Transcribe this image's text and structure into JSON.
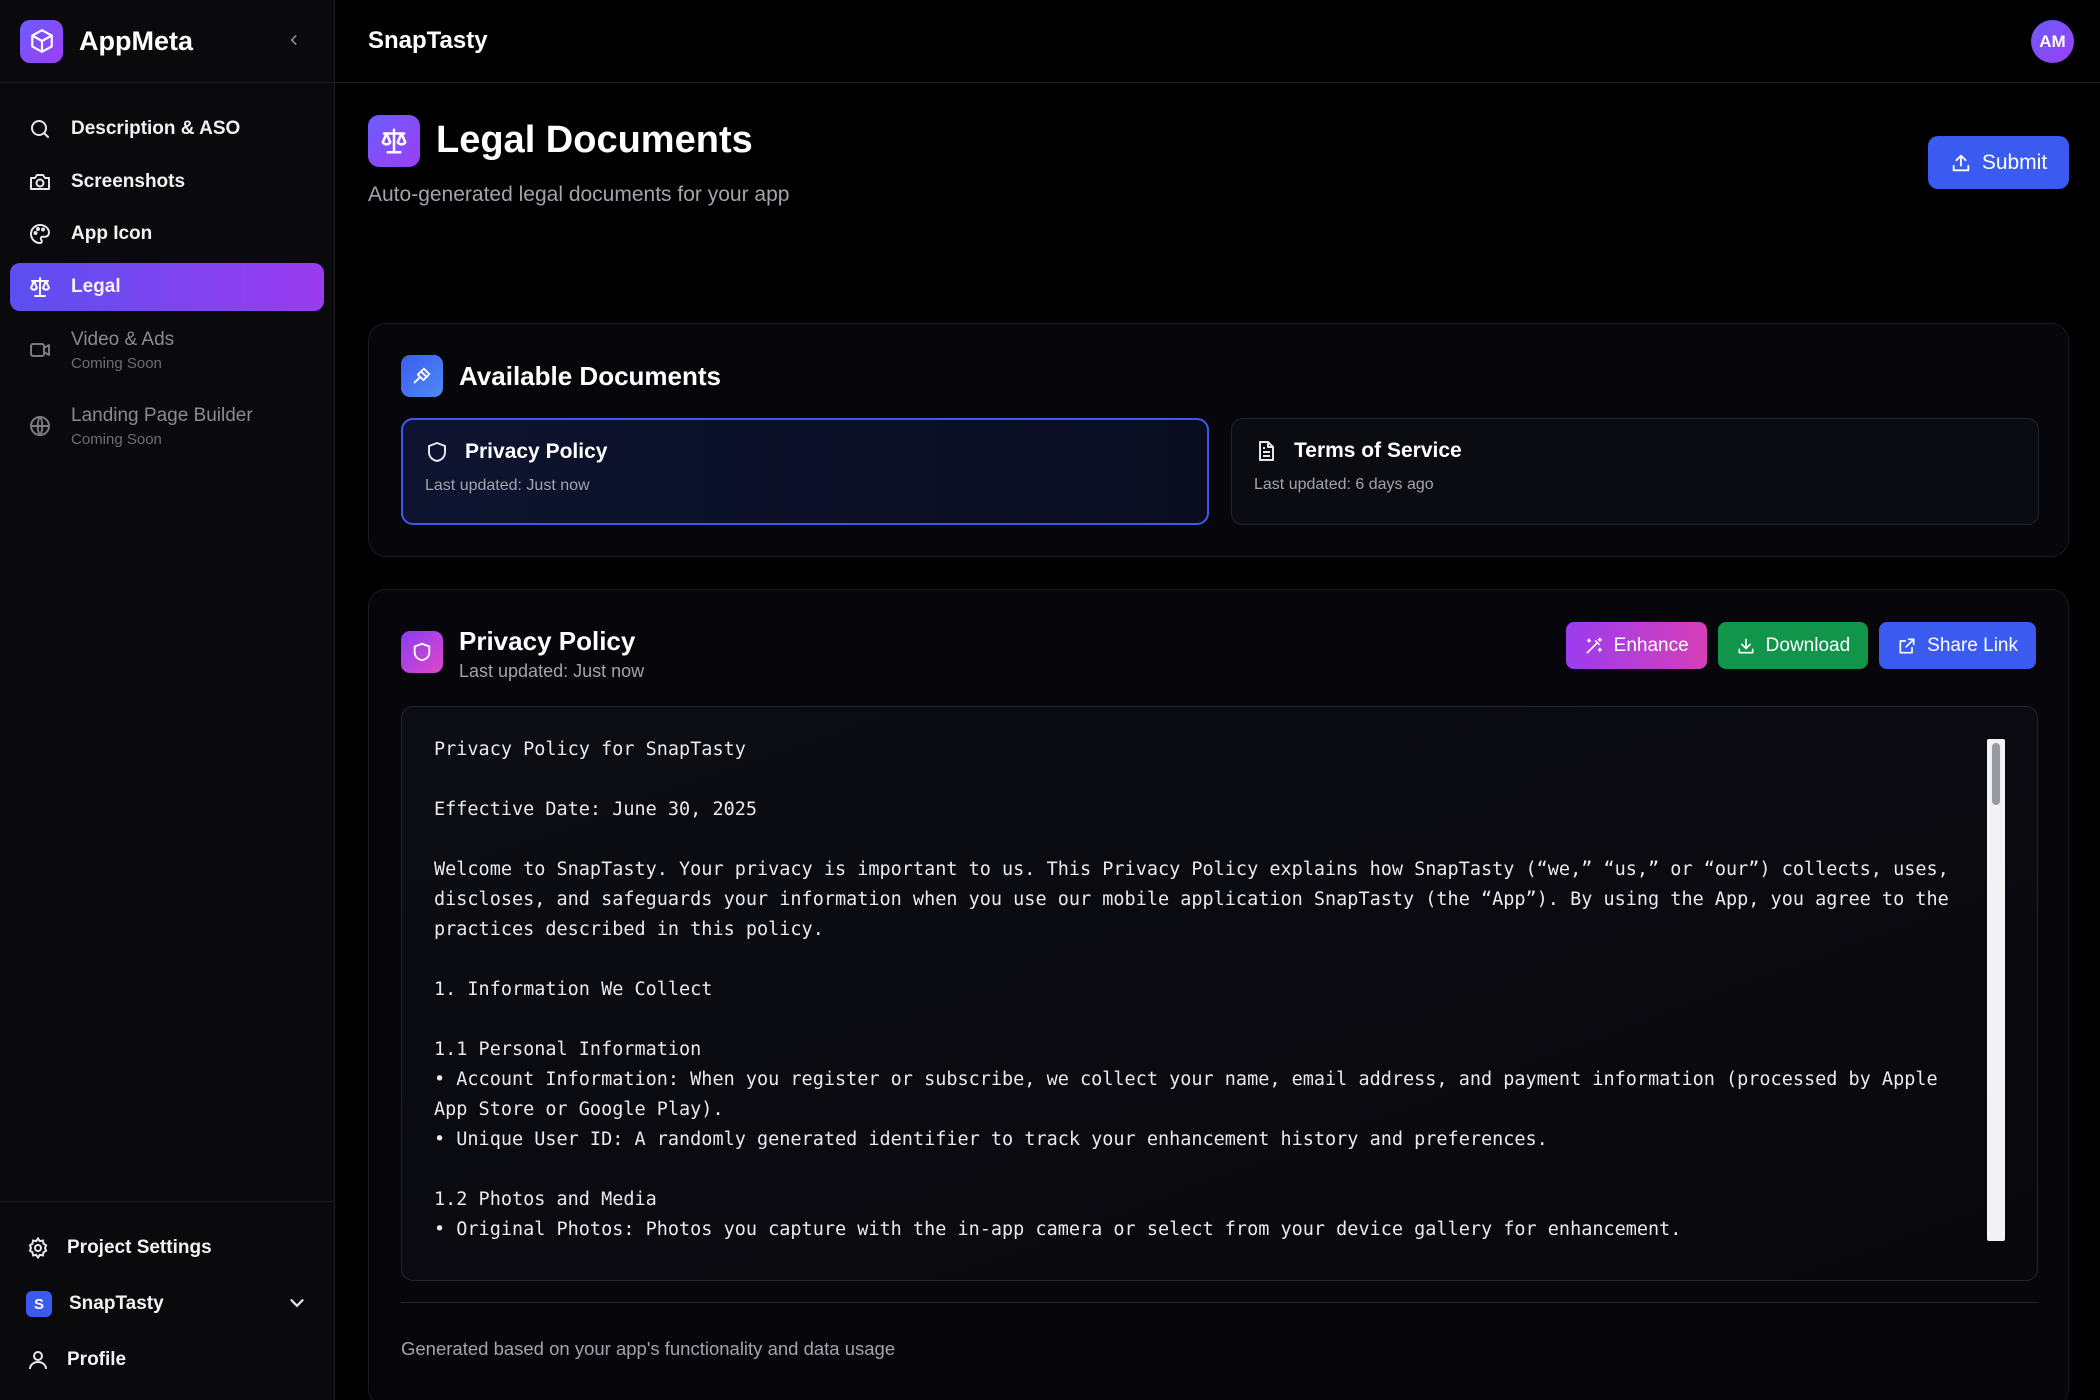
{
  "sidebar": {
    "brand": "AppMeta",
    "items": [
      {
        "label": "Description & ASO",
        "icon": "search-icon"
      },
      {
        "label": "Screenshots",
        "icon": "camera-icon"
      },
      {
        "label": "App Icon",
        "icon": "palette-icon"
      },
      {
        "label": "Legal",
        "icon": "scale-icon",
        "active": true
      },
      {
        "label": "Video & Ads",
        "sub": "Coming Soon",
        "icon": "video-icon"
      },
      {
        "label": "Landing Page Builder",
        "sub": "Coming Soon",
        "icon": "globe-icon"
      }
    ],
    "footer": {
      "settings": "Project Settings",
      "project_badge": "S",
      "project_name": "SnapTasty",
      "profile": "Profile"
    }
  },
  "topbar": {
    "app_name": "SnapTasty",
    "avatar_initials": "AM"
  },
  "page": {
    "title": "Legal Documents",
    "subtitle": "Auto-generated legal documents for your app",
    "submit_label": "Submit"
  },
  "available": {
    "title": "Available Documents",
    "docs": [
      {
        "title": "Privacy Policy",
        "updated": "Last updated: Just now",
        "selected": true
      },
      {
        "title": "Terms of Service",
        "updated": "Last updated: 6 days ago",
        "selected": false
      }
    ]
  },
  "viewer": {
    "title": "Privacy Policy",
    "updated": "Last updated: Just now",
    "actions": {
      "enhance": "Enhance",
      "download": "Download",
      "share": "Share Link"
    },
    "lines": [
      "Privacy Policy for SnapTasty",
      "",
      "Effective Date: June 30, 2025",
      "",
      "Welcome to SnapTasty. Your privacy is important to us. This Privacy Policy explains how SnapTasty (“we,” “us,” or “our”) collects, uses, discloses, and safeguards your information when you use our mobile application SnapTasty (the “App”). By using the App, you agree to the practices described in this policy.",
      "",
      "1. Information We Collect",
      "",
      "1.1 Personal Information",
      "• Account Information: When you register or subscribe, we collect your name, email address, and payment information (processed by Apple App Store or Google Play).",
      "• Unique User ID: A randomly generated identifier to track your enhancement history and preferences.",
      "",
      "1.2 Photos and Media",
      "• Original Photos: Photos you capture with the in-app camera or select from your device gallery for enhancement."
    ],
    "footnote": "Generated based on your app's functionality and data usage"
  },
  "colors": {
    "accent_blue": "#3b5bf0",
    "accent_purple": "#9a3cf0",
    "download_green": "#10954b",
    "background": "#000000"
  }
}
